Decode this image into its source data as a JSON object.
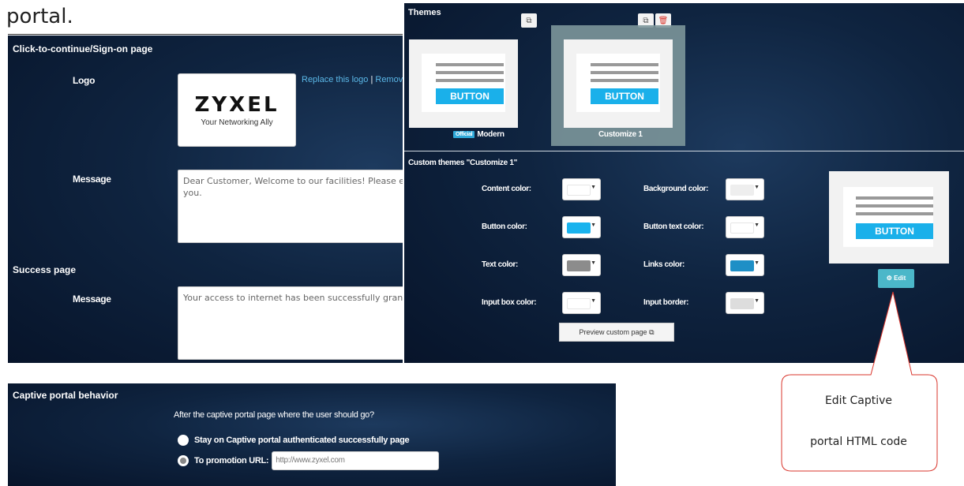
{
  "top_text": "portal.",
  "left_panel": {
    "sign_on_heading": "Click-to-continue/Sign-on page",
    "logo_label": "Logo",
    "logo_word": "ZYXEL",
    "logo_tagline": "Your Networking Ally",
    "replace_logo_link": "Replace this logo",
    "link_separator": "|",
    "remove_link": "Remov",
    "message_label": "Message",
    "message_value": "Dear Customer, Welcome to our facilities! Please e\nyou.",
    "success_heading": "Success page",
    "success_message_label": "Message",
    "success_message_value": "Your access to internet has been successfully grant"
  },
  "bottom_panel": {
    "heading": "Captive portal behavior",
    "question": "After the captive portal page where the user should go?",
    "option_stay": "Stay on Captive portal authenticated successfully page",
    "option_promo": "To promotion URL:",
    "promo_url": "http://www.zyxel.com",
    "selected_option": "To promotion URL:"
  },
  "themes_panel": {
    "title": "Themes",
    "theme_button_label": "BUTTON",
    "themes": [
      {
        "name": "Modern",
        "badge": "Official"
      },
      {
        "name": "Customize 1",
        "badge": ""
      }
    ],
    "selected_theme": "Customize 1",
    "custom_title": "Custom themes \"Customize 1\"",
    "colors": {
      "content": {
        "label": "Content color:",
        "value": "#ffffff"
      },
      "background": {
        "label": "Background color:",
        "value": "#eeeeee"
      },
      "button": {
        "label": "Button color:",
        "value": "#19b3ee"
      },
      "button_text": {
        "label": "Button text color:",
        "value": "#ffffff"
      },
      "text": {
        "label": "Text color:",
        "value": "#8c8c8c"
      },
      "links": {
        "label": "Links color:",
        "value": "#1e8fc6"
      },
      "input_box": {
        "label": "Input box color:",
        "value": "#ffffff"
      },
      "input_border": {
        "label": "Input border:",
        "value": "#dddddd"
      }
    },
    "preview_button": "Preview custom page",
    "edit_button": "Edit"
  },
  "callout": {
    "line1": "Edit Captive",
    "line2": "portal HTML code",
    "color": "#d9342b"
  },
  "icons": [
    "copy-icon",
    "trash-icon",
    "external-link-icon",
    "gear-icon",
    "caret-down-icon",
    "radio-icon"
  ]
}
